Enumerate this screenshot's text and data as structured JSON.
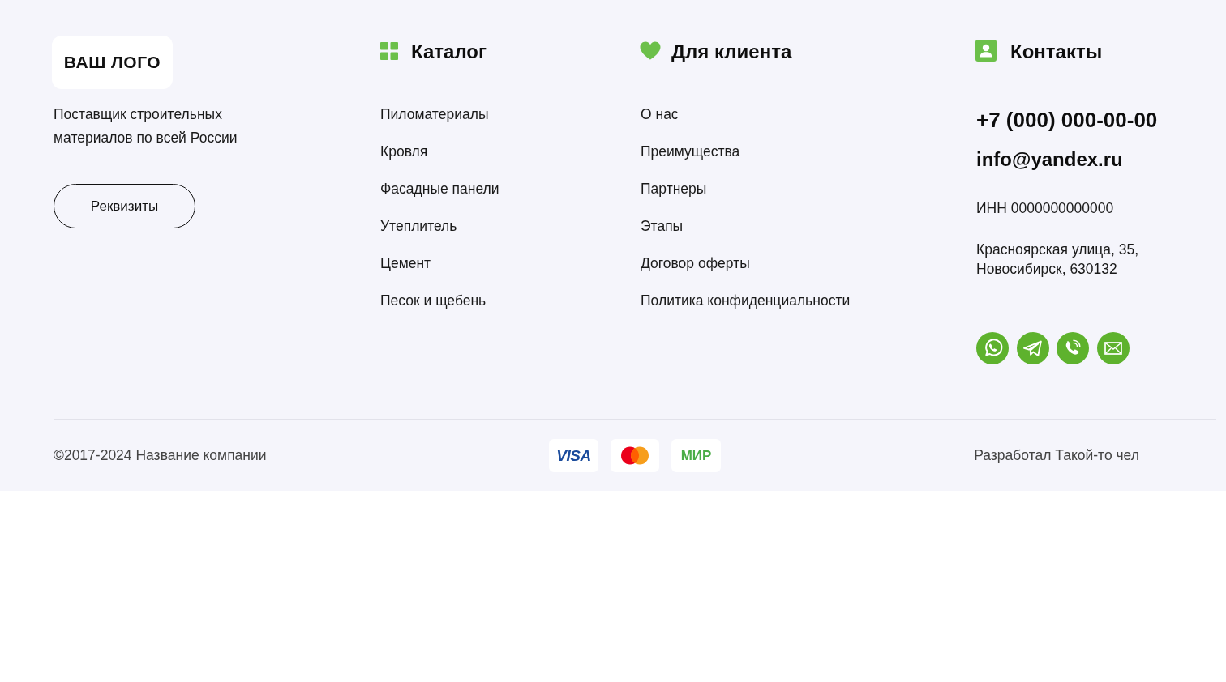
{
  "brand": {
    "logo": "ВАШ ЛОГО",
    "tagline": "Поставщик строительных материалов по всей России",
    "button": "Реквизиты"
  },
  "columns": [
    {
      "kind": "catalog",
      "title": "Каталог",
      "links": [
        "Пиломатериалы",
        "Кровля",
        "Фасадные панели",
        "Утеплитель",
        "Цемент",
        "Песок и щебень"
      ]
    },
    {
      "kind": "client",
      "title": "Для клиента",
      "links": [
        "О нас",
        "Преимущества",
        "Партнеры",
        "Этапы",
        "Договор оферты",
        "Политика конфиденциальности"
      ]
    }
  ],
  "contacts": {
    "title": "Контакты",
    "phone": "+7 (000) 000-00-00",
    "email": "info@yandex.ru",
    "inn": "ИНН 0000000000000",
    "address": "Красноярская улица, 35, Новосибирск, 630132",
    "social": [
      {
        "kind": "whatsapp"
      },
      {
        "kind": "telegram"
      },
      {
        "kind": "phone"
      },
      {
        "kind": "email"
      }
    ]
  },
  "bottom": {
    "copyright": "©2017-2024 Название компании",
    "payments": [
      {
        "kind": "visa",
        "label": "VISA"
      },
      {
        "kind": "mastercard"
      },
      {
        "kind": "mir",
        "label": "МИР"
      }
    ],
    "developer": "Разработал Такой-то чел"
  }
}
